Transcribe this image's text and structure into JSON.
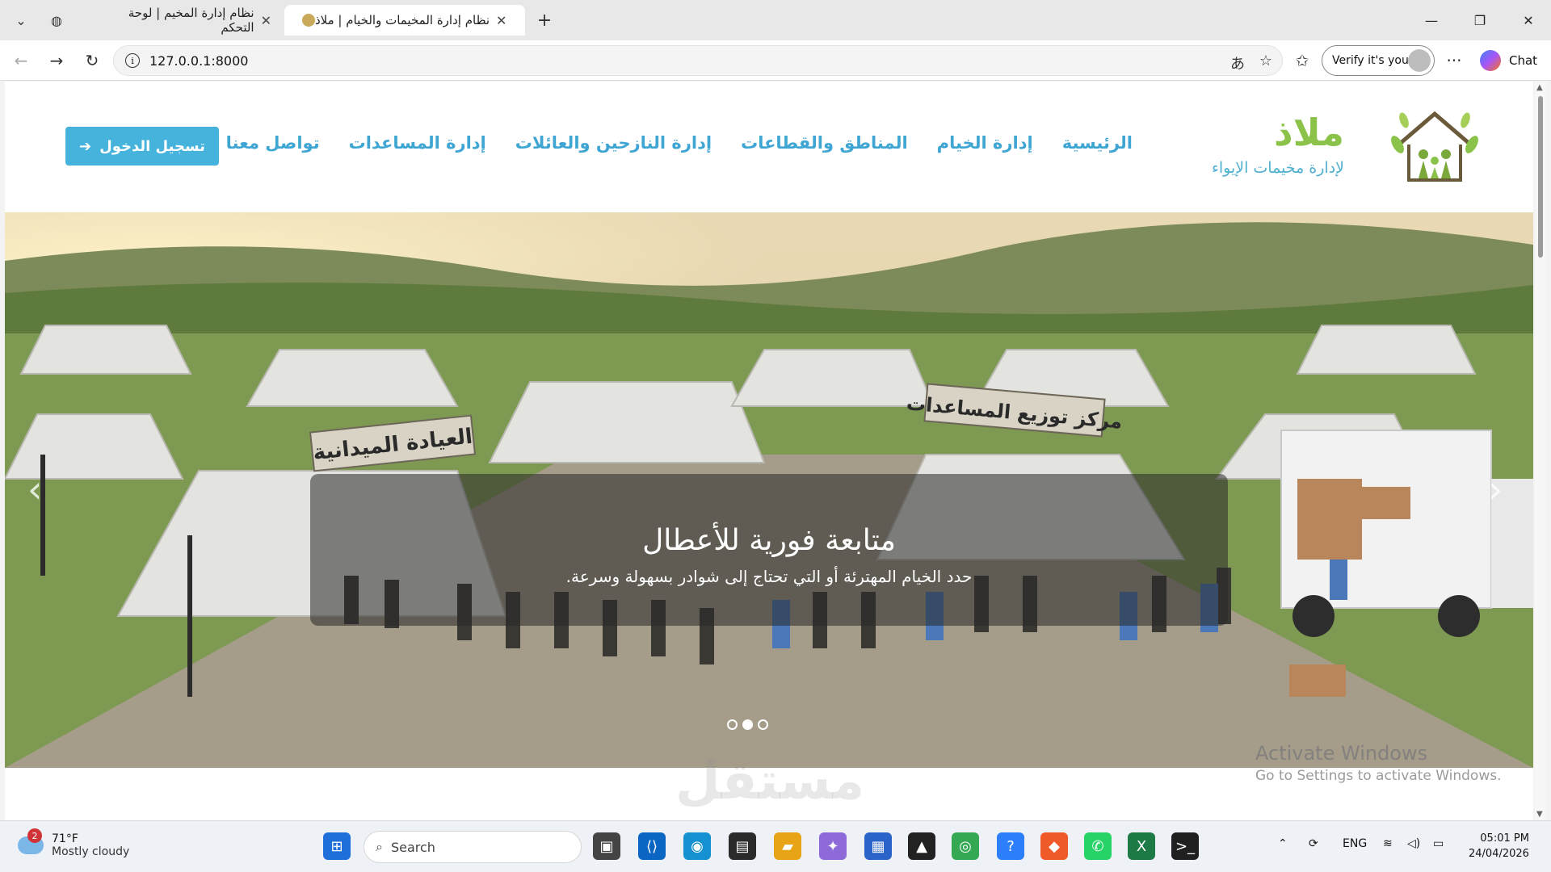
{
  "browser": {
    "tabs": [
      {
        "title": "نظام إدارة المخيم | لوحة التحكم",
        "active": false
      },
      {
        "title": "نظام إدارة المخيمات والخيام | ملاذ",
        "active": true
      }
    ],
    "url": "127.0.0.1:8000",
    "verify_label": "Verify it's you",
    "chat_label": "Chat"
  },
  "site": {
    "brand_title": "ملاذ",
    "brand_subtitle": "لإدارة مخيمات الإيواء",
    "nav": [
      "الرئيسية",
      "إدارة الخيام",
      "المناطق والقطاعات",
      "إدارة النازحين والعائلات",
      "إدارة المساعدات",
      "تواصل معنا"
    ],
    "login_label": "تسجيل الدخول",
    "hero": {
      "title": "متابعة فورية للأعطال",
      "subtitle": "حدد الخيام المهترئة أو التي تحتاج إلى شوادر بسهولة وسرعة.",
      "sign_left": "العيادة الميدانية",
      "sign_right": "مركز توزيع المساعدات",
      "active_slide": 2,
      "slide_count": 3
    }
  },
  "overlay": {
    "activate_title": "Activate Windows",
    "activate_sub": "Go to Settings to activate Windows.",
    "watermark": "مستقل"
  },
  "taskbar": {
    "weather_temp": "71°F",
    "weather_desc": "Mostly cloudy",
    "weather_badge": "2",
    "search_placeholder": "Search",
    "lang": "ENG",
    "time": "05:01 PM",
    "date": "24/04/2026"
  }
}
